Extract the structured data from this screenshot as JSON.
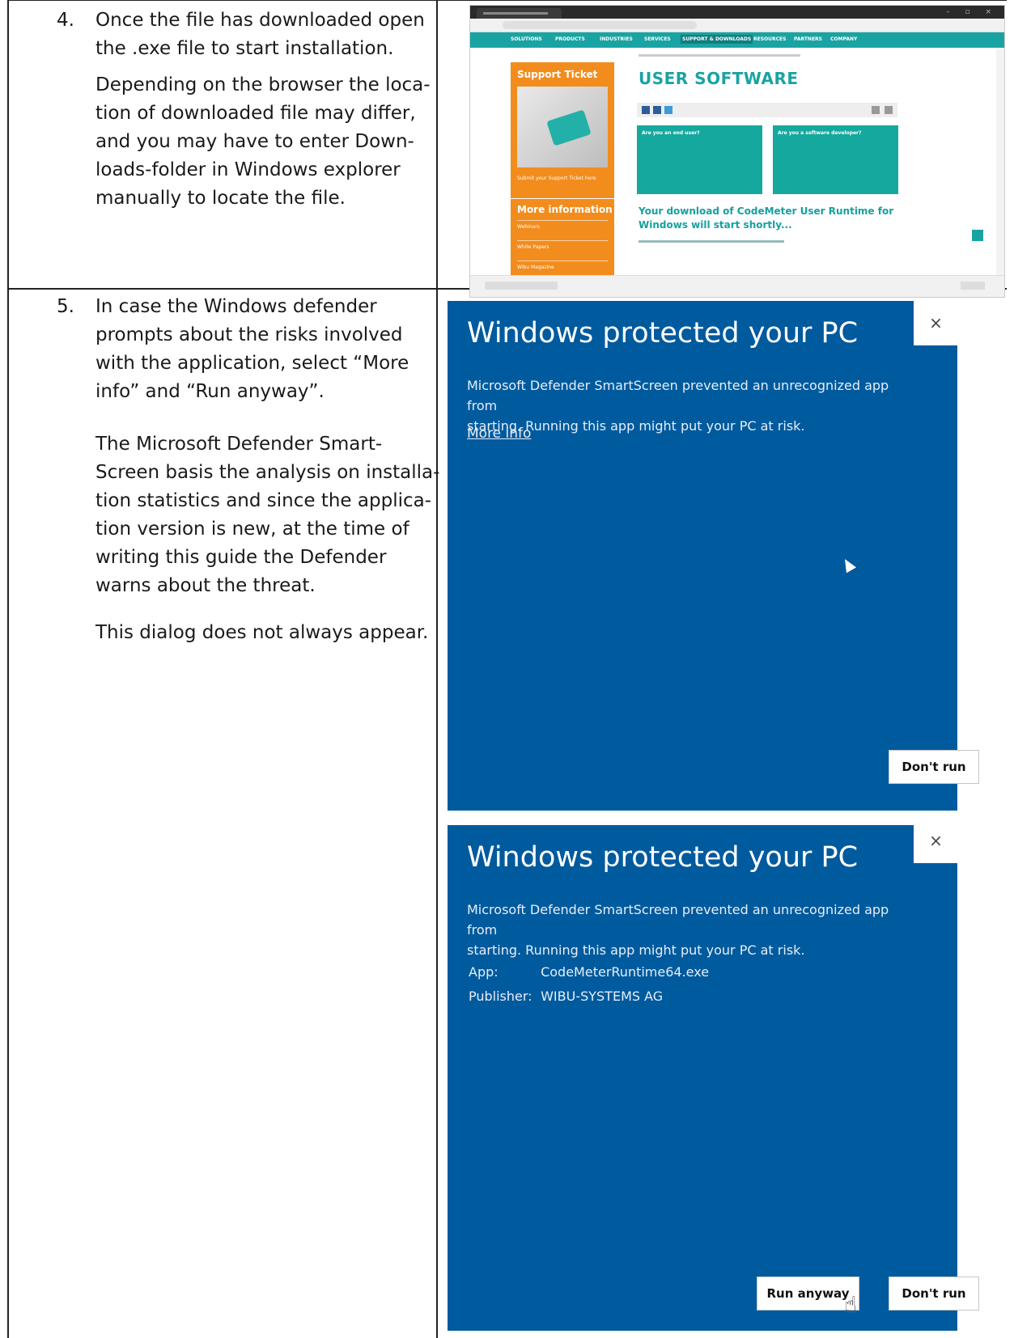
{
  "steps": [
    {
      "number": "4.",
      "lines": [
        "Once the file has downloaded open",
        "the .exe file to start installation."
      ],
      "paragraphs": [
        [
          "Depending on the browser the loca-",
          "tion of downloaded file may differ,",
          "and you may have to enter Down-",
          "loads-folder in Windows explorer",
          "manually to locate the file."
        ]
      ]
    },
    {
      "number": "5.",
      "lines": [
        "In case the Windows defender",
        "prompts about the risks involved",
        "with the application, select “More",
        "info” and “Run anyway”."
      ],
      "paragraphs": [
        [
          "The Microsoft Defender Smart-",
          "Screen basis the analysis on installa-",
          "tion statistics and since the applica-",
          "tion version is new, at the time of",
          "writing this guide the Defender",
          "warns about the threat."
        ],
        [
          "This dialog does not always appear."
        ]
      ]
    }
  ],
  "browser": {
    "nav": [
      "SOLUTIONS",
      "PRODUCTS",
      "INDUSTRIES",
      "SERVICES",
      "SUPPORT & DOWNLOADS",
      "RESOURCES",
      "PARTNERS",
      "COMPANY"
    ],
    "sidebar_title": "Support Ticket",
    "sidebar_sub": "Submit your Support Ticket here",
    "more_info_title": "More information",
    "more_info_items": [
      "Webinars",
      "White Papers",
      "Wibu Magazine"
    ],
    "page_title": "USER SOFTWARE",
    "card_left_title": "Are you an end user?",
    "card_right_title": "Are you a software developer?",
    "download_msg_line1": "Your download of CodeMeter User Runtime for",
    "download_msg_line2": "Windows will start shortly..."
  },
  "dialog1": {
    "close": "×",
    "title": "Windows protected your PC",
    "msg_line1": "Microsoft Defender SmartScreen prevented an unrecognized app from",
    "msg_line2": "starting. Running this app might put your PC at risk.",
    "more_info": "More info",
    "dont_run": "Don't run"
  },
  "dialog2": {
    "close": "×",
    "title": "Windows protected your PC",
    "msg_line1": "Microsoft Defender SmartScreen prevented an unrecognized app from",
    "msg_line2": "starting. Running this app might put your PC at risk.",
    "app_label": "App:",
    "app_value": "CodeMeterRuntime64.exe",
    "publisher_label": "Publisher:",
    "publisher_value": "WIBU-SYSTEMS AG",
    "run_anyway": "Run anyway",
    "dont_run": "Don't run"
  }
}
